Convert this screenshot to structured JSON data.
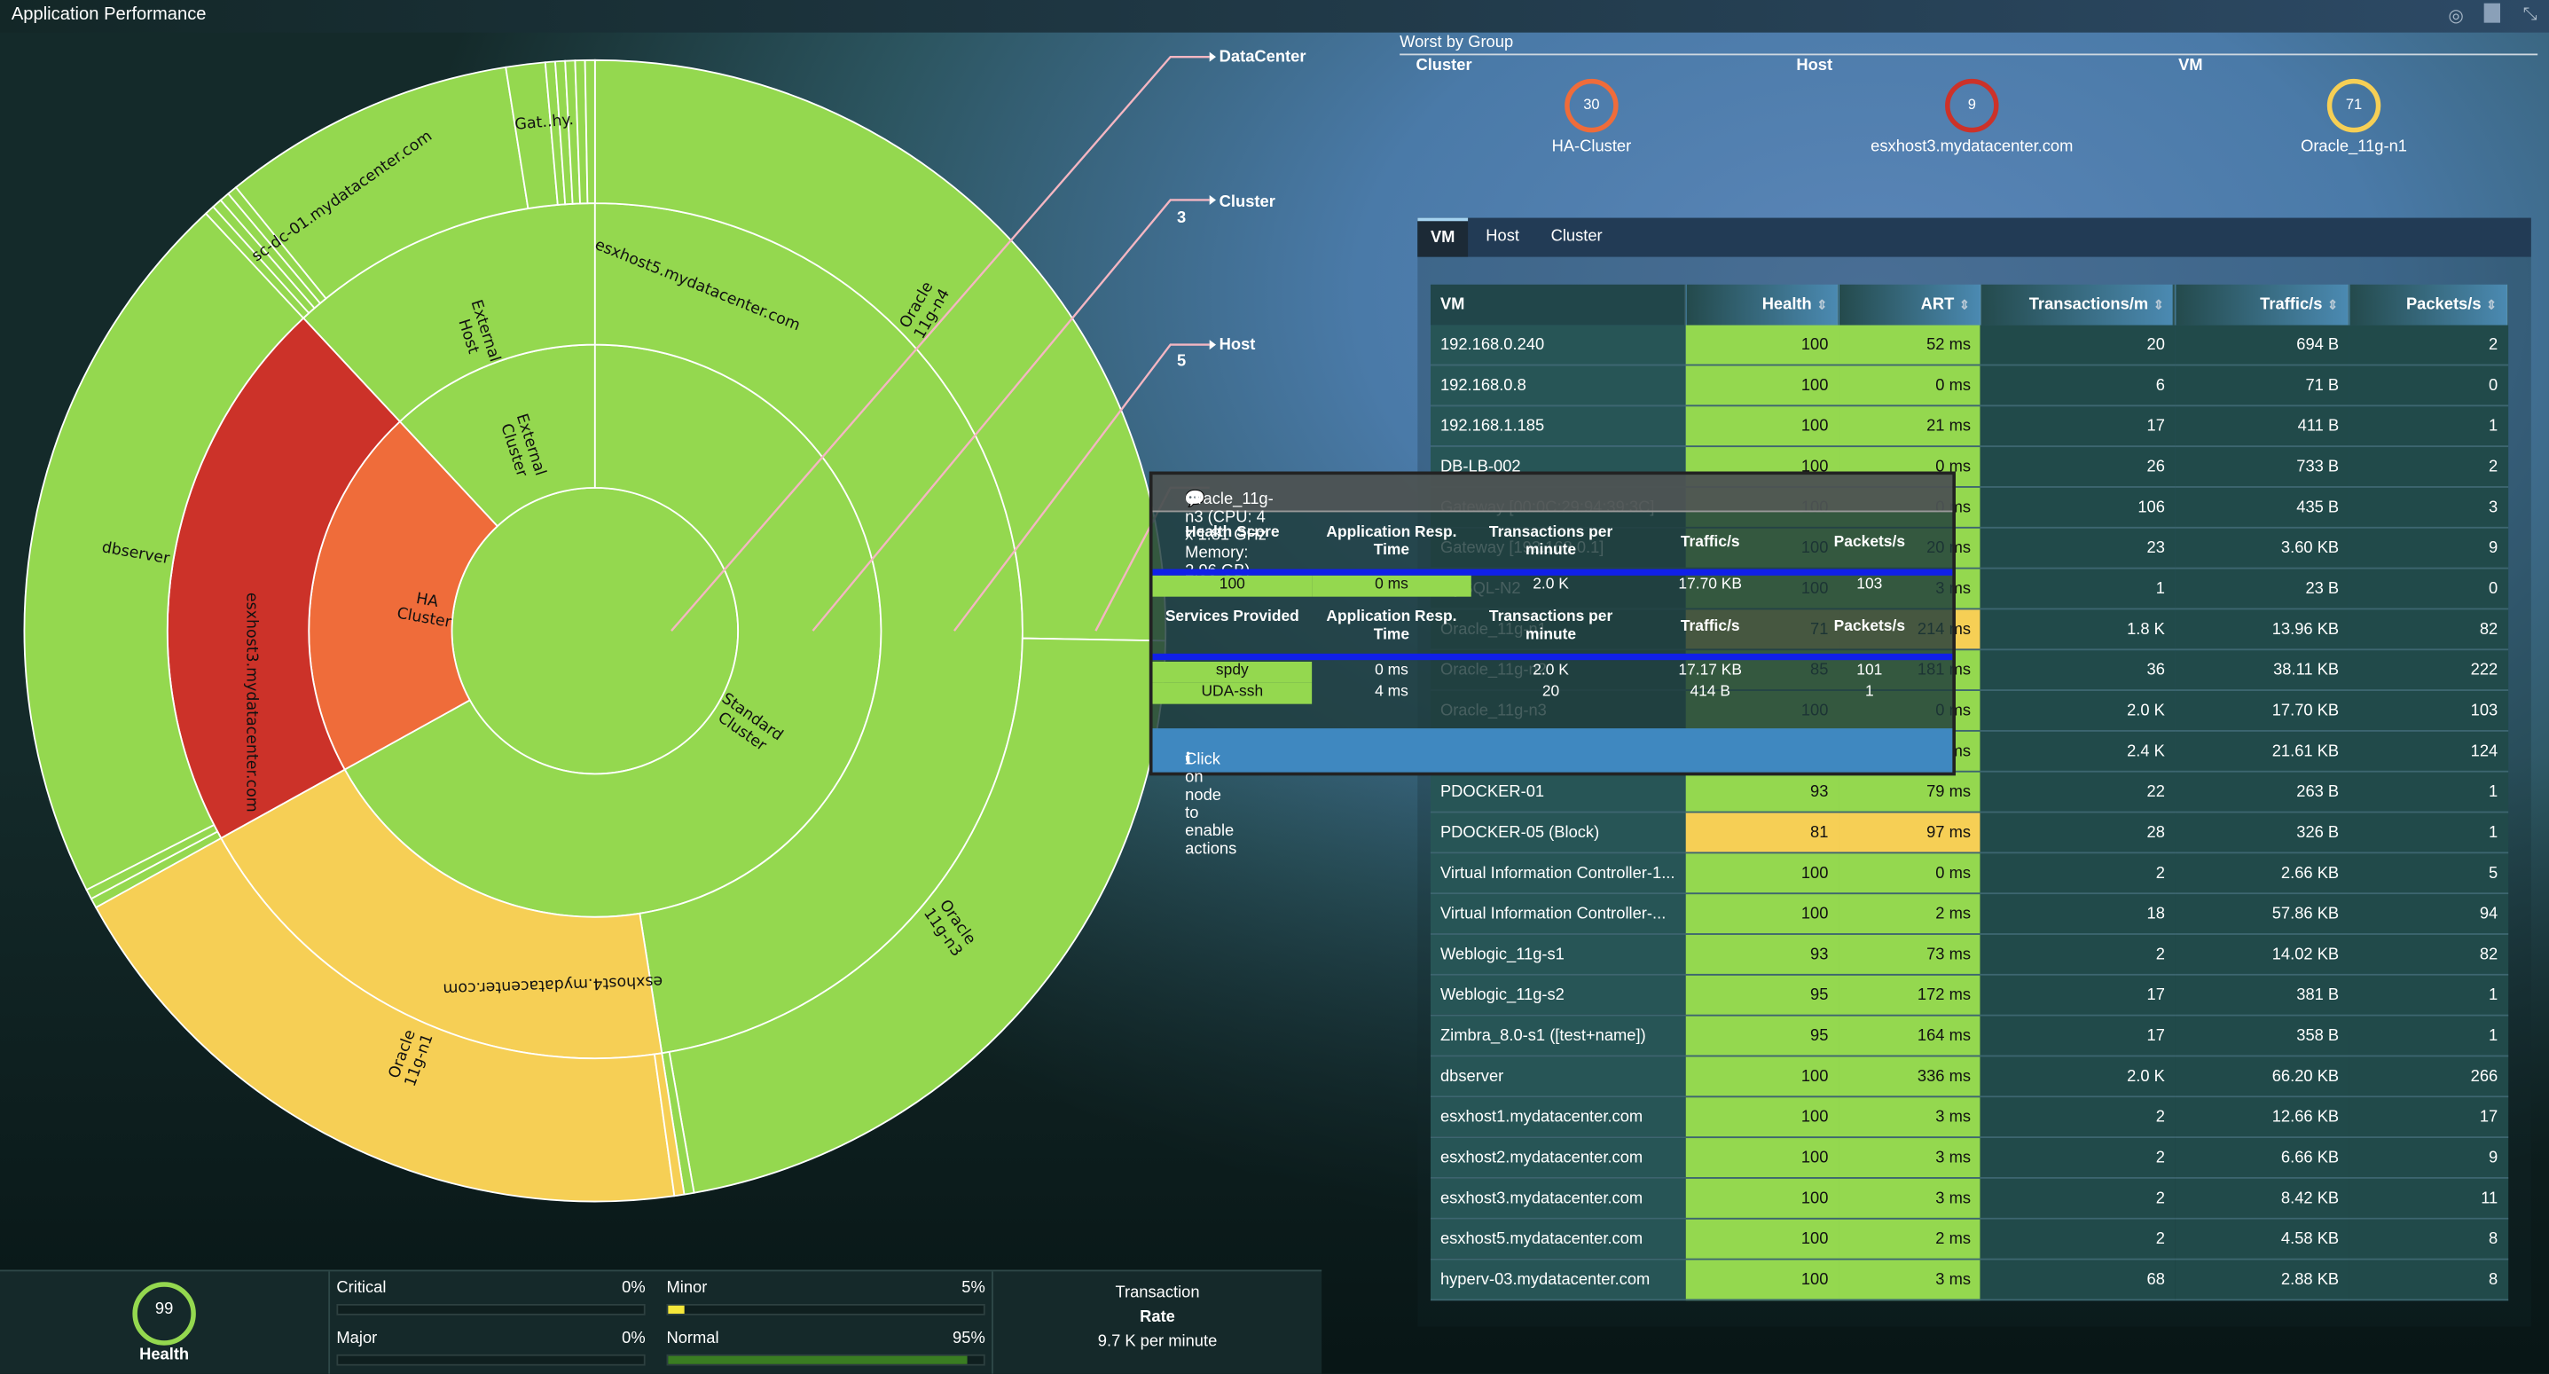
{
  "window": {
    "title": "Application Performance",
    "icons": [
      "target-icon",
      "maximize-icon",
      "collapse-icon"
    ]
  },
  "colors": {
    "normal": "#94d84f",
    "minor": "#f6cf55",
    "major": "#ef6c3a",
    "critical": "#cc3229",
    "leader": "#f4b6c2"
  },
  "sunburst": {
    "levels": [
      {
        "label": "DataCenter",
        "count": ""
      },
      {
        "label": "Cluster",
        "count": "3"
      },
      {
        "label": "Host",
        "count": "5"
      }
    ],
    "root": {
      "name": "",
      "status": "normal"
    },
    "clusters": [
      {
        "name": "External Cluster",
        "status": "normal"
      },
      {
        "name": "Standard Cluster",
        "status": "normal"
      },
      {
        "name": "HA Cluster",
        "status": "major"
      }
    ],
    "hosts": [
      {
        "name": "External Host",
        "status": "normal"
      },
      {
        "name": "esxhost5.mydatacenter.com",
        "status": "normal"
      },
      {
        "name": "esxhost4.mydatacenter.com",
        "status": "minor"
      },
      {
        "name": "esxhost3.mydatacenter.com",
        "status": "critical"
      }
    ],
    "vms": [
      {
        "name": "Oracle 11g-n4",
        "status": "normal"
      },
      {
        "name": "Oracle 11g-n3",
        "status": "normal"
      },
      {
        "name": "Oracle 11g-n1",
        "status": "minor"
      },
      {
        "name": "dbserver",
        "status": "normal"
      },
      {
        "name": "sc-dc-01.mydatacenter.com",
        "status": "normal"
      },
      {
        "name": "Gat..hy.",
        "status": "normal"
      }
    ]
  },
  "worst": {
    "title": "Worst by Group",
    "groups": [
      {
        "label": "Cluster",
        "score": "30",
        "name": "HA-Cluster",
        "color": "#ef6c3a"
      },
      {
        "label": "Host",
        "score": "9",
        "name": "esxhost3.mydatacenter.com",
        "color": "#cc3229"
      },
      {
        "label": "VM",
        "score": "71",
        "name": "Oracle_11g-n1",
        "color": "#f6cf55"
      }
    ]
  },
  "table": {
    "tabs": [
      "VM",
      "Host",
      "Cluster"
    ],
    "active_tab": "VM",
    "columns": [
      "VM",
      "Health",
      "ART",
      "Transactions/m",
      "Traffic/s",
      "Packets/s"
    ],
    "rows": [
      [
        "192.168.0.240",
        "100",
        "52 ms",
        "20",
        "694 B",
        "2",
        "normal"
      ],
      [
        "192.168.0.8",
        "100",
        "0 ms",
        "6",
        "71 B",
        "0",
        "normal"
      ],
      [
        "192.168.1.185",
        "100",
        "21 ms",
        "17",
        "411 B",
        "1",
        "normal"
      ],
      [
        "DB-LB-002",
        "100",
        "0 ms",
        "26",
        "733 B",
        "2",
        "normal"
      ],
      [
        "Gateway [00:0C:29:94:39:3C]",
        "100",
        "0 ms",
        "106",
        "435 B",
        "3",
        "normal"
      ],
      [
        "Gateway [192.168.0.1]",
        "100",
        "20 ms",
        "23",
        "3.60 KB",
        "9",
        "normal"
      ],
      [
        "MySQL-N2",
        "100",
        "3 ms",
        "1",
        "23 B",
        "0",
        "normal"
      ],
      [
        "Oracle_11g-n1",
        "71",
        "214 ms",
        "1.8 K",
        "13.96 KB",
        "82",
        "minor"
      ],
      [
        "Oracle_11g-n2",
        "85",
        "181 ms",
        "36",
        "38.11 KB",
        "222",
        "normal"
      ],
      [
        "Oracle_11g-n3",
        "100",
        "0 ms",
        "2.0 K",
        "17.70 KB",
        "103",
        "normal"
      ],
      [
        "Oracle_11g-n4",
        "100",
        "0 ms",
        "2.4 K",
        "21.61 KB",
        "124",
        "normal"
      ],
      [
        "PDOCKER-01",
        "93",
        "79 ms",
        "22",
        "263 B",
        "1",
        "normal"
      ],
      [
        "PDOCKER-05 (Block)",
        "81",
        "97 ms",
        "28",
        "326 B",
        "1",
        "minor"
      ],
      [
        "Virtual Information Controller-1...",
        "100",
        "0 ms",
        "2",
        "2.66 KB",
        "5",
        "normal"
      ],
      [
        "Virtual Information Controller-...",
        "100",
        "2 ms",
        "18",
        "57.86 KB",
        "94",
        "normal"
      ],
      [
        "Weblogic_11g-s1",
        "93",
        "73 ms",
        "2",
        "14.02 KB",
        "82",
        "normal"
      ],
      [
        "Weblogic_11g-s2",
        "95",
        "172 ms",
        "17",
        "381 B",
        "1",
        "normal"
      ],
      [
        "Zimbra_8.0-s1 ([test+name])",
        "95",
        "164 ms",
        "17",
        "358 B",
        "1",
        "normal"
      ],
      [
        "dbserver",
        "100",
        "336 ms",
        "2.0 K",
        "66.20 KB",
        "266",
        "normal"
      ],
      [
        "esxhost1.mydatacenter.com",
        "100",
        "3 ms",
        "2",
        "12.66 KB",
        "17",
        "normal"
      ],
      [
        "esxhost2.mydatacenter.com",
        "100",
        "3 ms",
        "2",
        "6.66 KB",
        "9",
        "normal"
      ],
      [
        "esxhost3.mydatacenter.com",
        "100",
        "3 ms",
        "2",
        "8.42 KB",
        "11",
        "normal"
      ],
      [
        "esxhost5.mydatacenter.com",
        "100",
        "2 ms",
        "2",
        "4.58 KB",
        "8",
        "normal"
      ],
      [
        "hyperv-03.mydatacenter.com",
        "100",
        "3 ms",
        "68",
        "2.88 KB",
        "8",
        "normal"
      ]
    ]
  },
  "tooltip": {
    "title": "Oracle_11g-n3 (CPU: 4 x 1.81 GHz Memory: 2.96 GB)",
    "head1": [
      "Health Score",
      "Application Resp. Time",
      "Transactions per minute",
      "Traffic/s",
      "Packets/s"
    ],
    "row1": [
      "100",
      "0 ms",
      "2.0 K",
      "17.70 KB",
      "103"
    ],
    "head2": [
      "Services Provided",
      "Application Resp. Time",
      "Transactions per minute",
      "Traffic/s",
      "Packets/s"
    ],
    "services": [
      [
        "spdy",
        "0 ms",
        "2.0 K",
        "17.17 KB",
        "101"
      ],
      [
        "UDA-ssh",
        "4 ms",
        "20",
        "414 B",
        "1"
      ]
    ],
    "footer": "Click on node to enable actions"
  },
  "summary": {
    "health": {
      "score": "99",
      "label": "Health",
      "value": 99
    },
    "bars": [
      {
        "label": "Critical",
        "pct": "0%",
        "value": 0,
        "color": "#cc3229"
      },
      {
        "label": "Minor",
        "pct": "5%",
        "value": 5,
        "color": "#f5e73a"
      },
      {
        "label": "Major",
        "pct": "0%",
        "value": 0,
        "color": "#ef6c3a"
      },
      {
        "label": "Normal",
        "pct": "95%",
        "value": 95,
        "color": "#3a7d22"
      }
    ],
    "rate": {
      "line1": "Transaction",
      "line2": "Rate",
      "value": "9.7 K per minute"
    }
  }
}
